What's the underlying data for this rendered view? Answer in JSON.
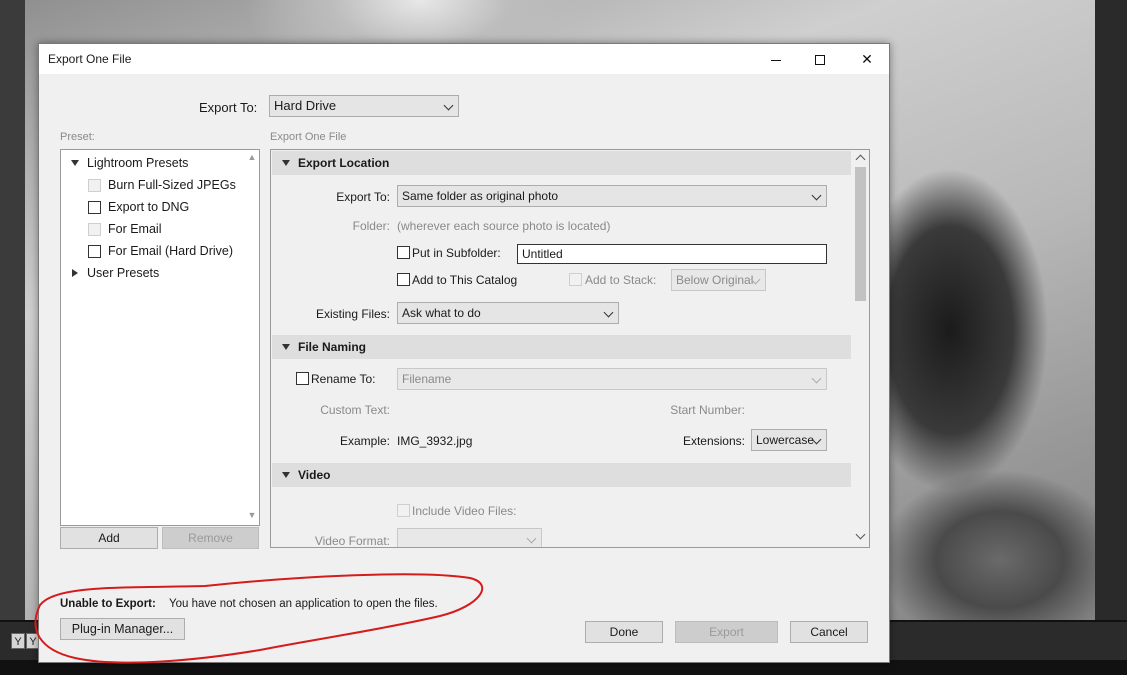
{
  "window": {
    "title": "Export One File"
  },
  "export_to": {
    "label": "Export To:",
    "value": "Hard Drive"
  },
  "preset": {
    "label": "Preset:",
    "lightroom_presets_label": "Lightroom Presets",
    "items": [
      {
        "label": "Burn Full-Sized JPEGs",
        "checkbox_enabled": false
      },
      {
        "label": "Export to DNG",
        "checkbox_enabled": true
      },
      {
        "label": "For Email",
        "checkbox_enabled": false
      },
      {
        "label": "For Email (Hard Drive)",
        "checkbox_enabled": true
      }
    ],
    "user_presets_label": "User Presets",
    "add_label": "Add",
    "remove_label": "Remove"
  },
  "settings": {
    "panel_label": "Export One File",
    "export_location": {
      "header": "Export Location",
      "export_to_label": "Export To:",
      "export_to_value": "Same folder as original photo",
      "folder_label": "Folder:",
      "folder_value": "(wherever each source photo is located)",
      "subfolder_label": "Put in Subfolder:",
      "subfolder_value": "Untitled",
      "add_catalog_label": "Add to This Catalog",
      "add_stack_label": "Add to Stack:",
      "stack_value": "Below Original",
      "existing_files_label": "Existing Files:",
      "existing_files_value": "Ask what to do"
    },
    "file_naming": {
      "header": "File Naming",
      "rename_label": "Rename To:",
      "rename_value": "Filename",
      "custom_text_label": "Custom Text:",
      "start_number_label": "Start Number:",
      "example_label": "Example:",
      "example_value": "IMG_3932.jpg",
      "extensions_label": "Extensions:",
      "extensions_value": "Lowercase"
    },
    "video": {
      "header": "Video",
      "include_label": "Include Video Files:",
      "format_label": "Video Format:"
    }
  },
  "footer": {
    "error_label": "Unable to Export:",
    "error_message": "You have not chosen an application to open the files.",
    "plugin_manager_label": "Plug-in Manager...",
    "done_label": "Done",
    "export_label": "Export",
    "cancel_label": "Cancel"
  },
  "background": {
    "filmstrip_button": "Y"
  },
  "colors": {
    "annotation": "#d41c1c",
    "section_header": "#dedede",
    "dialog_bg": "#f0f0f0"
  }
}
